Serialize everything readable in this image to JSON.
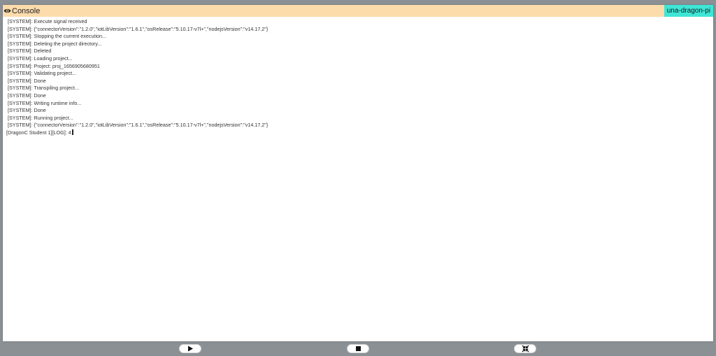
{
  "console": {
    "title": "Console",
    "device": "una-dragon-pi",
    "lines": [
      {
        "type": "system",
        "text": "[SYSTEM]: Execute signal received"
      },
      {
        "type": "system",
        "text": "[SYSTEM]: {\"connectorVersion\":\"1.2.0\",\"iotLibVersion\":\"1.6.1\",\"osRelease\":\"5.10.17-v7l+\",\"nodejsVersion\":\"v14.17.2\"}"
      },
      {
        "type": "system",
        "text": "[SYSTEM]: Stopping the current execution..."
      },
      {
        "type": "system",
        "text": "[SYSTEM]: Deleting the project directory..."
      },
      {
        "type": "system",
        "text": "[SYSTEM]: Deleted"
      },
      {
        "type": "system",
        "text": "[SYSTEM]: Loading project..."
      },
      {
        "type": "system",
        "text": "[SYSTEM]: Project: proj_1656905680951"
      },
      {
        "type": "system",
        "text": "[SYSTEM]: Validating project..."
      },
      {
        "type": "system",
        "text": "[SYSTEM]: Done"
      },
      {
        "type": "system",
        "text": "[SYSTEM]: Transpiling project..."
      },
      {
        "type": "system",
        "text": "[SYSTEM]: Done"
      },
      {
        "type": "system",
        "text": "[SYSTEM]: Writing runtime info..."
      },
      {
        "type": "system",
        "text": "[SYSTEM]: Done"
      },
      {
        "type": "system",
        "text": "[SYSTEM]: Running project..."
      },
      {
        "type": "system",
        "text": "[SYSTEM]: {\"connectorVersion\":\"1.2.0\",\"iotLibVersion\":\"1.6.1\",\"osRelease\":\"5.10.17-v7l+\",\"nodejsVersion\":\"v14.17.2\"}"
      },
      {
        "type": "user",
        "text": "[DragonC Student 1][LOG]: 4"
      }
    ]
  },
  "controls": {
    "play": "play-icon",
    "stop": "stop-icon",
    "collapse": "collapse-icon"
  },
  "colors": {
    "header_bg": "#fddcac",
    "badge_bg": "#3ee6d6",
    "backdrop": "#8b9095"
  }
}
